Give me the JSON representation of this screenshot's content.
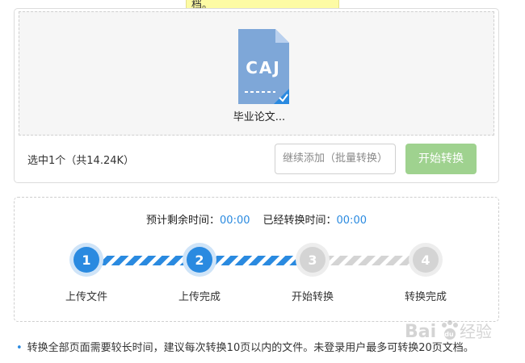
{
  "tooltip": {
    "text": "档。"
  },
  "upload": {
    "file_type_label": "CAJ",
    "file_name": "毕业论文...",
    "selected_info": "选中1个（共14.24K）",
    "continue_button": "继续添加（批量转换）",
    "start_button": "开始转换"
  },
  "progress": {
    "remaining_label": "预计剩余时间：",
    "remaining_value": "00:00",
    "elapsed_label": "已经转换时间：",
    "elapsed_value": "00:00",
    "steps": [
      {
        "number": "1",
        "label": "上传文件",
        "state": "done"
      },
      {
        "number": "2",
        "label": "上传完成",
        "state": "done"
      },
      {
        "number": "3",
        "label": "开始转换",
        "state": "pending"
      },
      {
        "number": "4",
        "label": "转换完成",
        "state": "pending"
      }
    ]
  },
  "tip": {
    "text": "转换全部页面需要较长时间，建议每次转换10页以内的文件。未登录用户最多可转换20页文档。"
  },
  "watermark": {
    "text": "Baidu经验"
  },
  "colors": {
    "accent_blue": "#2a8ae0",
    "step_pending": "#d4d4d4",
    "start_button_bg": "#9fd28f",
    "tooltip_bg": "#fdfba4",
    "file_icon_bg": "#7ea7d8"
  }
}
